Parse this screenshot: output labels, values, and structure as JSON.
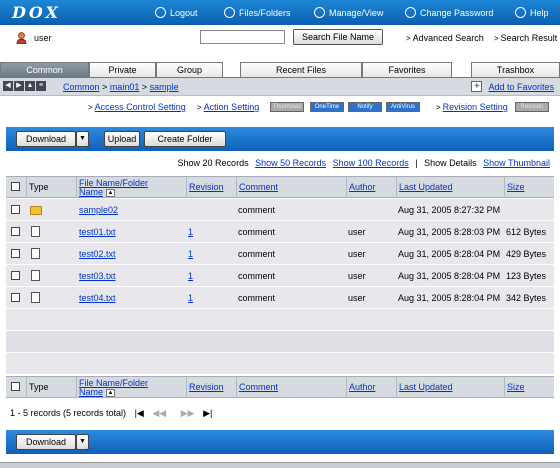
{
  "header": {
    "logo": "DOX",
    "nav": [
      {
        "label": "Logout",
        "icon": "power-icon"
      },
      {
        "label": "Files/Folders",
        "icon": "globe-icon"
      },
      {
        "label": "Manage/View",
        "icon": "gauge-icon"
      },
      {
        "label": "Change Password",
        "icon": "refresh-icon"
      },
      {
        "label": "Help",
        "icon": "help-icon"
      }
    ]
  },
  "user": {
    "name": "user"
  },
  "search": {
    "value": "",
    "button_label": "Search File Name",
    "advanced_label": "Advanced Search",
    "results_label": "Search Result"
  },
  "tabs": {
    "left": [
      "Common",
      "Private",
      "Group"
    ],
    "right": [
      "Recent Files",
      "Favorites",
      "Trashbox"
    ],
    "active": "Common"
  },
  "breadcrumb": {
    "items": [
      "Common",
      "main01",
      "sample"
    ],
    "separator": ">"
  },
  "favorites_link": "Add to Favorites",
  "settings": {
    "access_control": "Access Control Setting",
    "action_setting": "Action Setting",
    "badges": [
      {
        "label": "Thumbnail",
        "state": "off"
      },
      {
        "label": "OneTime",
        "state": "on"
      },
      {
        "label": "Notify",
        "state": "on"
      },
      {
        "label": "AntiVirus",
        "state": "on"
      }
    ],
    "revision_setting": "Revision Setting",
    "revision_badge": "Revision"
  },
  "toolbar": {
    "download": "Download",
    "upload": "Upload",
    "create_folder": "Create Folder"
  },
  "show_options": {
    "current": "Show 20 Records",
    "opt50": "Show 50 Records",
    "opt100": "Show 100 Records",
    "separator": "|",
    "details": "Show Details",
    "thumbnail": "Show Thumbnail"
  },
  "table": {
    "headers": {
      "type": "Type",
      "name_line1": "File Name/Folder",
      "name_line2": "Name",
      "revision": "Revision",
      "comment": "Comment",
      "author": "Author",
      "updated": "Last Updated",
      "size": "Size"
    },
    "rows": [
      {
        "kind": "folder",
        "name": "sample02",
        "revision": "",
        "comment": "comment",
        "author": "",
        "updated": "Aug 31, 2005 8:27:32 PM",
        "size": ""
      },
      {
        "kind": "file",
        "name": "test01.txt",
        "revision": "1",
        "comment": "comment",
        "author": "user",
        "updated": "Aug 31, 2005 8:28:03 PM",
        "size": "612 Bytes"
      },
      {
        "kind": "file",
        "name": "test02.txt",
        "revision": "1",
        "comment": "comment",
        "author": "user",
        "updated": "Aug 31, 2005 8:28:04 PM",
        "size": "429 Bytes"
      },
      {
        "kind": "file",
        "name": "test03.txt",
        "revision": "1",
        "comment": "comment",
        "author": "user",
        "updated": "Aug 31, 2005 8:28:04 PM",
        "size": "123 Bytes"
      },
      {
        "kind": "file",
        "name": "test04.txt",
        "revision": "1",
        "comment": "comment",
        "author": "user",
        "updated": "Aug 31, 2005 8:28:04 PM",
        "size": "342 Bytes"
      }
    ]
  },
  "pager": {
    "summary": "1 - 5 records (5 records total)",
    "first": "|◀",
    "prev": "◀◀",
    "next": "▶▶",
    "last": "▶|"
  },
  "colors": {
    "accent": "#1473c9",
    "tab_active": "#7a8692",
    "link": "#0033cc",
    "row_bg": "#e8e8ec"
  }
}
